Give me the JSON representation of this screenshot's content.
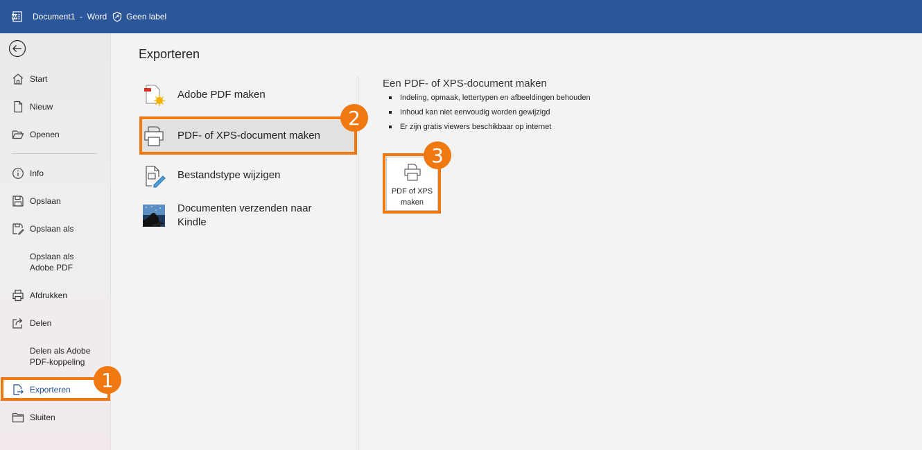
{
  "titlebar": {
    "doc_title": "Document1  -  Word",
    "label": "Geen label",
    "background": "#2b579a"
  },
  "sidebar": {
    "items": [
      {
        "label": "Start",
        "icon": "home-icon"
      },
      {
        "label": "Nieuw",
        "icon": "new-document-icon"
      },
      {
        "label": "Openen",
        "icon": "folder-open-icon"
      },
      {
        "label": "Info",
        "icon": "info-icon"
      },
      {
        "label": "Opslaan",
        "icon": "save-icon"
      },
      {
        "label": "Opslaan als",
        "icon": "save-as-icon"
      },
      {
        "label": "Opslaan als\nAdobe PDF",
        "icon": ""
      },
      {
        "label": "Afdrukken",
        "icon": "print-icon"
      },
      {
        "label": "Delen",
        "icon": "share-icon"
      },
      {
        "label": "Delen als Adobe\nPDF-koppeling",
        "icon": ""
      },
      {
        "label": "Exporteren",
        "icon": "export-icon",
        "active": true
      },
      {
        "label": "Sluiten",
        "icon": "close-folder-icon"
      }
    ]
  },
  "main": {
    "title": "Exporteren",
    "options": [
      {
        "label": "Adobe PDF maken",
        "icon": "adobe-pdf-icon"
      },
      {
        "label": "PDF- of XPS-document maken",
        "icon": "pdf-xps-icon",
        "selected": true
      },
      {
        "label": "Bestandstype wijzigen",
        "icon": "change-file-type-icon"
      },
      {
        "label": "Documenten verzenden naar\nKindle",
        "icon": "kindle-icon"
      }
    ]
  },
  "detail": {
    "title": "Een PDF- of XPS-document maken",
    "bullets": [
      "Indeling, opmaak, lettertypen en afbeeldingen behouden",
      "Inhoud kan niet eenvoudig worden gewijzigd",
      "Er zijn gratis viewers beschikbaar op internet"
    ],
    "button_label": "PDF of XPS\nmaken"
  },
  "callouts": {
    "step1": "1",
    "step2": "2",
    "step3": "3",
    "color": "#f07810"
  }
}
